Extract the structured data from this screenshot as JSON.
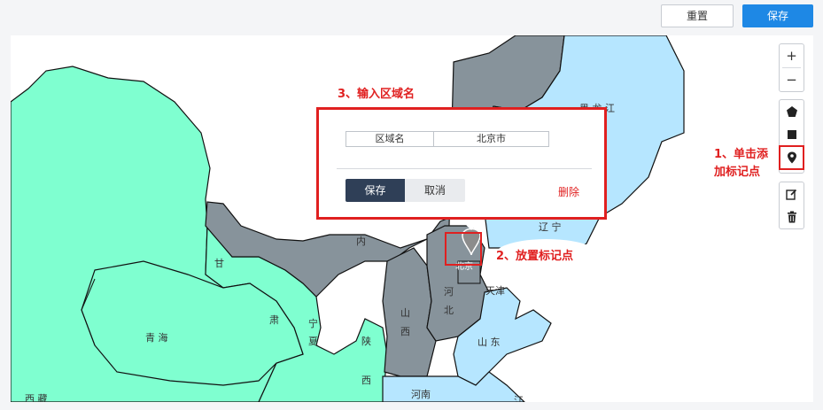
{
  "toolbar": {
    "reset_label": "重置",
    "save_label": "保存"
  },
  "map_controls": {
    "zoom_in": "+",
    "zoom_out": "−",
    "tools": [
      "polygon-tool",
      "rectangle-tool",
      "marker-tool"
    ],
    "edit_tools": [
      "edit-tool",
      "delete-tool"
    ]
  },
  "map": {
    "province_labels": {
      "heilongjiang": "黑 龙 江",
      "liaoning": "辽 宁",
      "neimenggu": "内",
      "gansu": "甘",
      "ningxia_1": "宁",
      "ningxia_2": "夏",
      "gansu_su": "肃",
      "qinghai": "青 海",
      "shaanxi_1": "陕",
      "shaanxi_2": "西",
      "shanxi_1": "山",
      "shanxi_2": "西",
      "hebei_1": "河",
      "hebei_2": "北",
      "tianjin": "天津",
      "beijing": "北京",
      "shandong": "山 东",
      "henan": "河南",
      "jiangsu": "江",
      "xizang": "西 藏"
    },
    "colors": {
      "grey_region": "#87939b",
      "green_region": "#7fffd0",
      "blue_region": "#b6e6ff",
      "border": "#111111"
    }
  },
  "annotations": {
    "step1_line1": "1、单击添",
    "step1_line2": "加标记点",
    "step2": "2、放置标记点",
    "step3": "3、输入区域名"
  },
  "popup": {
    "field_key": "区域名",
    "field_value": "北京市",
    "save_label": "保存",
    "cancel_label": "取消",
    "delete_label": "删除"
  }
}
